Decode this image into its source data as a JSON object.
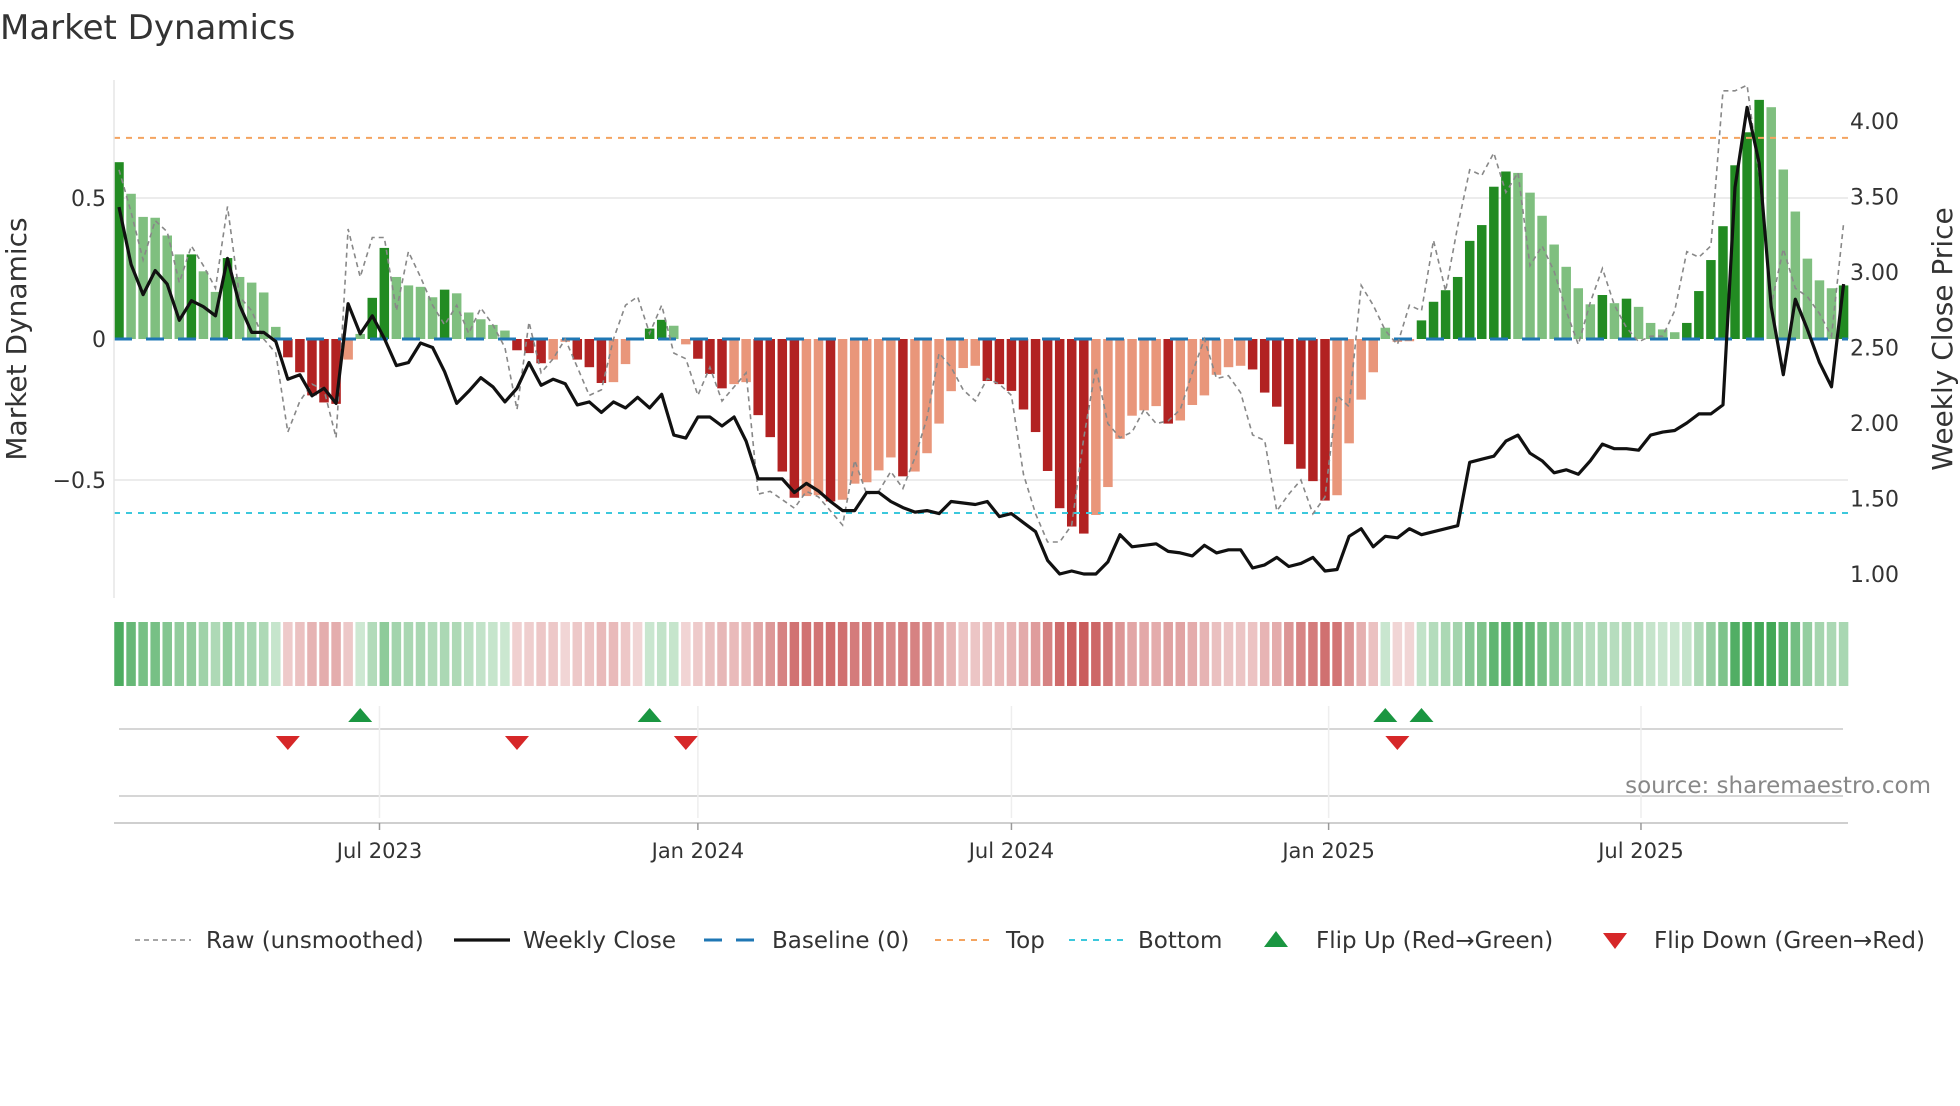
{
  "title": "Market Dynamics",
  "source": "source: sharemaestro.com",
  "colors": {
    "bar_pos_strong": "#228b22",
    "bar_pos_weak": "#7fbf7f",
    "bar_neg_strong": "#b22222",
    "bar_neg_weak": "#e9967a",
    "close": "#111111",
    "raw": "#888888",
    "baseline": "#1f77b4",
    "top": "#f4a460",
    "bottom": "#3cc8dc",
    "flip_up": "#1a9641",
    "flip_down": "#d62728"
  },
  "chart_data": {
    "type": "bar",
    "title": "Market Dynamics",
    "ylabel": "Market Dynamics",
    "y2label": "Weekly Close Price",
    "ylim": [
      -0.93,
      0.93
    ],
    "y2lim": [
      0.88,
      4.29
    ],
    "yticks": [
      {
        "v": 0.5,
        "label": "0.5"
      },
      {
        "v": 0,
        "label": "0"
      },
      {
        "v": -0.5,
        "label": "−0.5"
      }
    ],
    "y2ticks": [
      {
        "v": 4.0,
        "label": "4.00"
      },
      {
        "v": 3.5,
        "label": "3.50"
      },
      {
        "v": 3.0,
        "label": "3.00"
      },
      {
        "v": 2.5,
        "label": "2.50"
      },
      {
        "v": 2.0,
        "label": "2.00"
      },
      {
        "v": 1.5,
        "label": "1.50"
      },
      {
        "v": 1.0,
        "label": "1.00"
      }
    ],
    "xticks": [
      {
        "week": 22.6,
        "label": "Jul 2023"
      },
      {
        "week": 49.0,
        "label": "Jan 2024"
      },
      {
        "week": 75.0,
        "label": "Jul 2024"
      },
      {
        "week": 101.3,
        "label": "Jan 2025"
      },
      {
        "week": 127.2,
        "label": "Jul 2025"
      }
    ],
    "top_level": 0.713,
    "bottom_level": -0.617,
    "baseline": 0,
    "dynamics": [
      0.627,
      0.515,
      0.433,
      0.43,
      0.367,
      0.3,
      0.3,
      0.24,
      0.167,
      0.287,
      0.22,
      0.2,
      0.165,
      0.043,
      -0.065,
      -0.118,
      -0.2,
      -0.225,
      -0.23,
      -0.073,
      0.018,
      0.146,
      0.323,
      0.22,
      0.19,
      0.185,
      0.148,
      0.175,
      0.162,
      0.094,
      0.07,
      0.05,
      0.03,
      -0.04,
      -0.05,
      -0.086,
      -0.073,
      -0.01,
      -0.073,
      -0.1,
      -0.156,
      -0.153,
      -0.089,
      -0.003,
      0.037,
      0.068,
      0.047,
      -0.019,
      -0.07,
      -0.124,
      -0.175,
      -0.16,
      -0.153,
      -0.27,
      -0.348,
      -0.47,
      -0.563,
      -0.557,
      -0.554,
      -0.576,
      -0.57,
      -0.513,
      -0.508,
      -0.466,
      -0.42,
      -0.487,
      -0.47,
      -0.405,
      -0.3,
      -0.185,
      -0.103,
      -0.095,
      -0.149,
      -0.16,
      -0.184,
      -0.25,
      -0.33,
      -0.468,
      -0.6,
      -0.665,
      -0.69,
      -0.624,
      -0.525,
      -0.354,
      -0.272,
      -0.253,
      -0.238,
      -0.3,
      -0.289,
      -0.234,
      -0.2,
      -0.127,
      -0.1,
      -0.095,
      -0.108,
      -0.19,
      -0.24,
      -0.373,
      -0.46,
      -0.504,
      -0.573,
      -0.554,
      -0.37,
      -0.215,
      -0.118,
      0.04,
      -0.01,
      -0.008,
      0.066,
      0.132,
      0.173,
      0.22,
      0.348,
      0.404,
      0.54,
      0.594,
      0.589,
      0.519,
      0.437,
      0.335,
      0.256,
      0.18,
      0.123,
      0.156,
      0.127,
      0.143,
      0.114,
      0.057,
      0.034,
      0.024,
      0.057,
      0.17,
      0.28,
      0.4,
      0.616,
      0.733,
      0.848,
      0.822,
      0.601,
      0.452,
      0.285,
      0.208,
      0.18,
      0.19
    ],
    "raw": [
      0.6,
      0.45,
      0.28,
      0.42,
      0.38,
      0.2,
      0.33,
      0.26,
      0.18,
      0.47,
      0.15,
      0.1,
      0.0,
      -0.05,
      -0.33,
      -0.22,
      -0.16,
      -0.18,
      -0.35,
      0.39,
      0.22,
      0.36,
      0.36,
      0.1,
      0.31,
      0.22,
      0.12,
      0.05,
      0.12,
      0.02,
      0.11,
      0.05,
      -0.03,
      -0.25,
      0.06,
      -0.12,
      -0.07,
      0.0,
      -0.1,
      -0.2,
      -0.18,
      0.0,
      0.12,
      0.15,
      0.02,
      0.12,
      -0.05,
      -0.07,
      -0.2,
      -0.1,
      -0.22,
      -0.17,
      -0.12,
      -0.55,
      -0.54,
      -0.57,
      -0.6,
      -0.54,
      -0.56,
      -0.61,
      -0.66,
      -0.43,
      -0.55,
      -0.54,
      -0.47,
      -0.53,
      -0.42,
      -0.28,
      -0.05,
      -0.1,
      -0.18,
      -0.22,
      -0.14,
      -0.16,
      -0.2,
      -0.48,
      -0.62,
      -0.72,
      -0.72,
      -0.66,
      -0.35,
      -0.1,
      -0.3,
      -0.35,
      -0.33,
      -0.25,
      -0.3,
      -0.29,
      -0.25,
      -0.12,
      0.0,
      -0.14,
      -0.13,
      -0.19,
      -0.34,
      -0.36,
      -0.61,
      -0.55,
      -0.5,
      -0.62,
      -0.56,
      -0.2,
      -0.24,
      0.19,
      0.12,
      0.03,
      -0.02,
      0.12,
      0.1,
      0.35,
      0.17,
      0.4,
      0.6,
      0.58,
      0.66,
      0.52,
      0.59,
      0.26,
      0.33,
      0.24,
      0.1,
      -0.02,
      0.13,
      0.25,
      0.12,
      0.04,
      -0.01,
      0.01,
      0.01,
      0.1,
      0.31,
      0.29,
      0.33,
      0.88,
      0.88,
      0.9,
      0.58,
      0.12,
      0.32,
      0.18,
      0.15,
      0.09,
      0.01,
      0.41
    ],
    "close": [
      3.43,
      3.05,
      2.85,
      3.01,
      2.92,
      2.68,
      2.81,
      2.77,
      2.71,
      3.09,
      2.78,
      2.6,
      2.6,
      2.54,
      2.29,
      2.32,
      2.18,
      2.23,
      2.13,
      2.79,
      2.59,
      2.71,
      2.56,
      2.38,
      2.4,
      2.53,
      2.5,
      2.34,
      2.13,
      2.21,
      2.3,
      2.24,
      2.14,
      2.23,
      2.4,
      2.25,
      2.29,
      2.26,
      2.12,
      2.14,
      2.07,
      2.14,
      2.1,
      2.17,
      2.1,
      2.19,
      1.92,
      1.9,
      2.04,
      2.04,
      1.98,
      2.04,
      1.88,
      1.63,
      1.63,
      1.63,
      1.54,
      1.6,
      1.55,
      1.48,
      1.42,
      1.42,
      1.54,
      1.54,
      1.48,
      1.44,
      1.41,
      1.42,
      1.4,
      1.48,
      1.47,
      1.46,
      1.48,
      1.38,
      1.4,
      1.34,
      1.28,
      1.09,
      1.0,
      1.02,
      1.0,
      1.0,
      1.08,
      1.26,
      1.18,
      1.19,
      1.2,
      1.15,
      1.14,
      1.12,
      1.19,
      1.14,
      1.16,
      1.16,
      1.04,
      1.06,
      1.11,
      1.05,
      1.07,
      1.11,
      1.02,
      1.03,
      1.25,
      1.3,
      1.18,
      1.25,
      1.24,
      1.3,
      1.26,
      1.28,
      1.3,
      1.32,
      1.74,
      1.76,
      1.78,
      1.88,
      1.92,
      1.8,
      1.75,
      1.67,
      1.69,
      1.66,
      1.75,
      1.86,
      1.83,
      1.83,
      1.82,
      1.92,
      1.94,
      1.95,
      2.0,
      2.06,
      2.06,
      2.12,
      3.56,
      4.09,
      3.72,
      2.77,
      2.32,
      2.82,
      2.62,
      2.4,
      2.24,
      2.92
    ],
    "flip_up_weeks": [
      21,
      45,
      106,
      109
    ],
    "flip_down_weeks": [
      15,
      34,
      48,
      107
    ],
    "legend": [
      {
        "key": "raw",
        "label": "Raw (unsmoothed)"
      },
      {
        "key": "close",
        "label": "Weekly Close"
      },
      {
        "key": "baseline",
        "label": "Baseline (0)"
      },
      {
        "key": "top",
        "label": "Top"
      },
      {
        "key": "bottom",
        "label": "Bottom"
      },
      {
        "key": "flip_up",
        "label": "Flip Up (Red→Green)"
      },
      {
        "key": "flip_down",
        "label": "Flip Down (Green→Red)"
      }
    ]
  }
}
